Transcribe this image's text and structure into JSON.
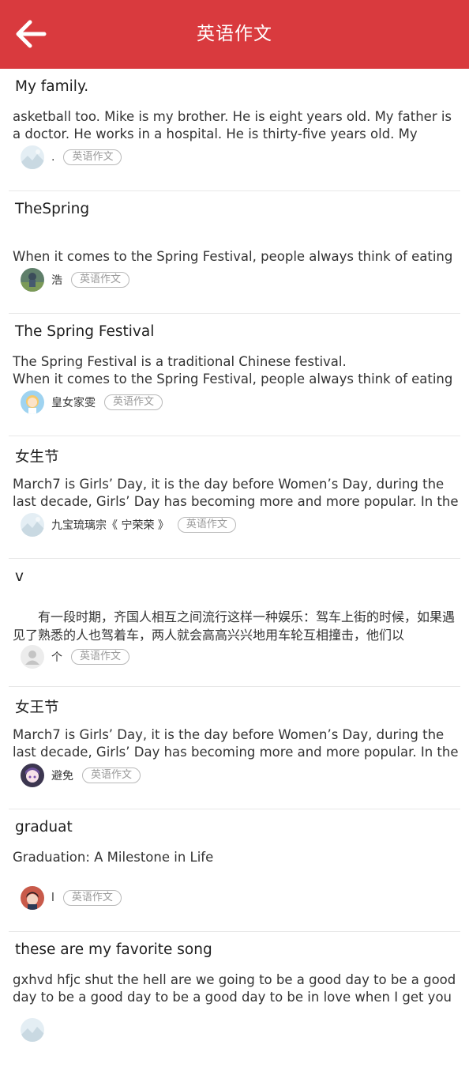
{
  "header": {
    "title": "英语作文",
    "background_color": "#d93a3e",
    "back_icon": "arrow-left-icon"
  },
  "articles": [
    {
      "title": "My family.",
      "excerpt": "asketball too. Mike is my brother. He is eight years old. My father is a doctor. He works in a hospital. He is thirty-five years old. My mother",
      "author": ".",
      "tag": "英语作文",
      "avatar": "landscape-avatar"
    },
    {
      "title": "TheSpring",
      "excerpt": "When it comes to the Spring Festival, people always think of eating",
      "author": "浩",
      "tag": "英语作文",
      "avatar": "photo-avatar"
    },
    {
      "title": "The Spring Festival",
      "excerpt": "The Spring Festival is a traditional Chinese festival.\nWhen it comes to the Spring Festival, people always think of eating",
      "author": "皇女家雯",
      "tag": "英语作文",
      "avatar": "girl-cartoon-avatar"
    },
    {
      "title": "女生节",
      "excerpt": "March7 is Girls’ Day, it is the day before Women’s Day, during the last decade, Girls’ Day has becoming more and more popular. In the",
      "author": "九宝琉璃宗《 宁荣荣 》",
      "tag": "英语作文",
      "avatar": "landscape-avatar"
    },
    {
      "title": "v",
      "excerpt": "　　有一段时期，齐国人相互之间流行这样一种娱乐：驾车上街的时候，如果遇见了熟悉的人也驾着车，两人就会高高兴兴地用车轮互相撞击，他们以",
      "author": "个",
      "tag": "英语作文",
      "avatar": "default-user-avatar"
    },
    {
      "title": "女王节",
      "excerpt": "March7 is Girls’ Day, it is the day before Women’s Day, during the last decade, Girls’ Day has becoming more and more popular. In the",
      "author": "避免",
      "tag": "英语作文",
      "avatar": "anime-girl-avatar"
    },
    {
      "title": "graduat",
      "excerpt": "Graduation: A Milestone in Life",
      "author": "l",
      "tag": "英语作文",
      "avatar": "anime-boy-avatar"
    },
    {
      "title": "these are my favorite song",
      "excerpt": "gxhvd hfjc shut the hell are we going to be a good day to be a good day to be a good day to be a good day to be in love when I get you",
      "author": "",
      "tag": "",
      "avatar": "landscape-avatar"
    }
  ]
}
